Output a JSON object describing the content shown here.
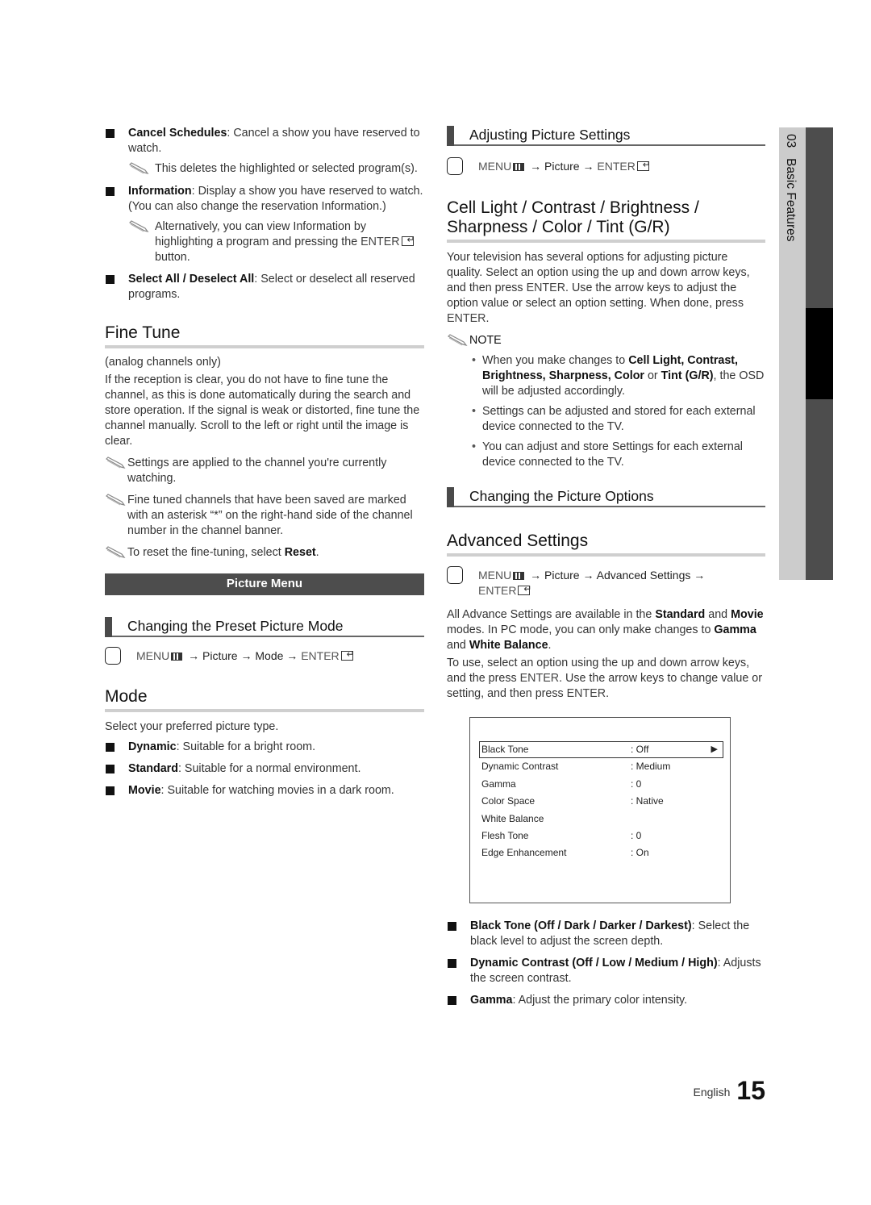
{
  "left": {
    "bullets_top": [
      {
        "term": "Cancel Schedules",
        "text": ": Cancel a show you have reserved to watch.",
        "note": "This deletes the highlighted or selected program(s)."
      },
      {
        "term": "Information",
        "text": ": Display a show you have reserved to watch. (You can also change the reservation Information.)",
        "note_pre": "Alternatively, you can view Information by highlighting a program and pressing the ",
        "note_enter": "ENTER",
        "note_post": " button."
      },
      {
        "term": "Select All / Deselect All",
        "text": ": Select or deselect all reserved programs."
      }
    ],
    "fine_tune": {
      "title": "Fine Tune",
      "subtitle": "(analog channels only)",
      "body": "If the reception is clear, you do not have to fine tune the channel, as this is done automatically during the search and store operation. If the signal is weak or distorted, fine tune the channel manually. Scroll to the left or right until the image is clear.",
      "notes": [
        "Settings are applied to the channel you're currently watching.",
        "Fine tuned channels that have been saved are marked with an asterisk “*” on the right-hand side of the channel number in the channel banner."
      ],
      "reset_note_pre": "To reset the fine-tuning, select ",
      "reset_note_term": "Reset",
      "reset_note_post": "."
    },
    "banner": "Picture Menu",
    "preset": {
      "title": "Changing the Preset Picture Mode",
      "menu": {
        "menu": "MENU",
        "arrow": " → ",
        "p1": "Picture",
        "p2": "Mode",
        "enter": "ENTER"
      }
    },
    "mode": {
      "title": "Mode",
      "intro": "Select your preferred picture type.",
      "items": [
        {
          "term": "Dynamic",
          "text": ": Suitable for a bright room."
        },
        {
          "term": "Standard",
          "text": ": Suitable for a normal environment."
        },
        {
          "term": "Movie",
          "text": ": Suitable for watching movies in a dark room."
        }
      ]
    }
  },
  "right": {
    "adjusting": {
      "title": "Adjusting Picture Settings",
      "menu": {
        "menu": "MENU",
        "arrow": " → ",
        "p1": "Picture",
        "enter": "ENTER"
      }
    },
    "cell": {
      "title_line1": "Cell Light / Contrast / Brightness /",
      "title_line2": "Sharpness / Color / Tint (G/R)",
      "body_pre": "Your television has several options for adjusting picture quality. Select an option using the up and down arrow keys, and then press ",
      "body_enter1": "ENTER",
      "body_mid": ". Use the arrow keys to adjust the option value or select an option setting. When done, press ",
      "body_enter2": "ENTER",
      "body_post": ".",
      "note_label": "NOTE",
      "note_items": [
        {
          "pre": "When you make changes to ",
          "b1": "Cell Light, Contrast, Brightness, Sharpness, Color",
          "mid": " or ",
          "b2": "Tint (G/R)",
          "post": ", the OSD will be adjusted accordingly."
        },
        {
          "pre": "Settings can be adjusted and stored for each external device connected to the TV."
        },
        {
          "pre": "You can adjust and store Settings for each external device connected to the TV."
        }
      ]
    },
    "options": {
      "title": "Changing the Picture Options"
    },
    "advanced": {
      "title": "Advanced Settings",
      "menu": {
        "menu": "MENU",
        "arrow": " → ",
        "p1": "Picture",
        "p2": "Advanced Settings",
        "arrow_end": " →",
        "enter": "ENTER"
      },
      "p1_pre": "All Advance Settings are available in the ",
      "p1_b1": "Standard",
      "p1_mid": " and ",
      "p1_b2": "Movie",
      "p1_mid2": " modes. In PC mode, you can only make changes to ",
      "p1_b3": "Gamma",
      "p1_mid3": " and ",
      "p1_b4": "White Balance",
      "p1_post": ".",
      "p2_pre": "To use, select an option using the up and down arrow keys, and the press ",
      "p2_e1": "ENTER",
      "p2_mid": ". Use the arrow keys to change value or setting, and then press ",
      "p2_e2": "ENTER",
      "p2_post": "."
    },
    "osd": {
      "rows": [
        {
          "label": "Black Tone",
          "value": ": Off",
          "selected": true,
          "arrow": "▶"
        },
        {
          "label": "Dynamic Contrast",
          "value": ": Medium"
        },
        {
          "label": "Gamma",
          "value": ": 0"
        },
        {
          "label": "Color Space",
          "value": ": Native"
        },
        {
          "label": "White Balance",
          "value": ""
        },
        {
          "label": "Flesh Tone",
          "value": ": 0"
        },
        {
          "label": "Edge Enhancement",
          "value": ": On"
        }
      ]
    },
    "bottom_bullets": [
      {
        "term": "Black Tone (Off / Dark / Darker / Darkest)",
        "text": ": Select the black level to adjust the screen depth."
      },
      {
        "term": "Dynamic Contrast (Off / Low / Medium / High)",
        "text": ": Adjusts the screen contrast."
      },
      {
        "term": "Gamma",
        "text": ": Adjust the primary color intensity."
      }
    ]
  },
  "sidetab": {
    "chapter": "03",
    "label": "Basic Features"
  },
  "footer": {
    "language": "English",
    "page": "15"
  }
}
